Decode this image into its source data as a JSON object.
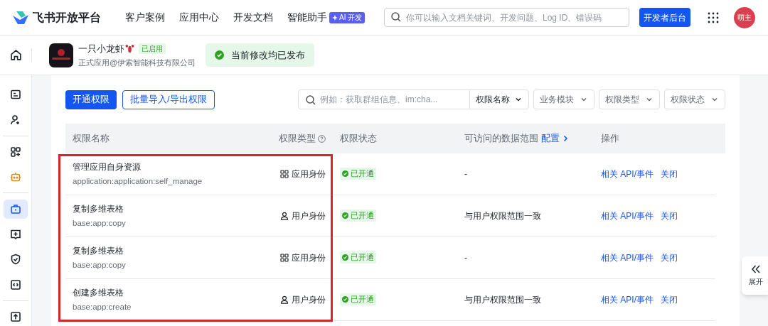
{
  "header": {
    "logo_text": "飞书开放平台",
    "nav": [
      {
        "label": "客户案例"
      },
      {
        "label": "应用中心"
      },
      {
        "label": "开发文档"
      },
      {
        "label": "智能助手",
        "badge": "AI 开发"
      }
    ],
    "search": {
      "placeholder": "你可以输入文档关键词、开发问题、Log ID、错误码"
    },
    "console_button": "开发者后台",
    "avatar": "萌主"
  },
  "app_bar": {
    "name": "一只小龙虾",
    "status": "已启用",
    "subtitle": "正式应用@伊索智能科技有限公司",
    "notice": "当前修改均已发布"
  },
  "sidebar": [
    {
      "kind": "console",
      "selected": false
    },
    {
      "kind": "user-add",
      "selected": false
    },
    {
      "kind": "divider"
    },
    {
      "kind": "apps",
      "selected": false
    },
    {
      "kind": "bot",
      "selected": false
    },
    {
      "kind": "divider"
    },
    {
      "kind": "briefcase",
      "selected": true
    },
    {
      "kind": "add-card",
      "selected": false
    },
    {
      "kind": "shield",
      "selected": false
    },
    {
      "kind": "code",
      "selected": false
    },
    {
      "kind": "divider"
    },
    {
      "kind": "upload",
      "selected": false
    }
  ],
  "toolbar": {
    "primary_button": "开通权限",
    "secondary_button": "批量导入/导出权限",
    "search": {
      "placeholder": "例如：获取群组信息、im:cha...",
      "scope": "权限名称"
    },
    "filters": [
      "业务模块",
      "权限类型",
      "权限状态"
    ]
  },
  "table": {
    "columns": [
      "权限名称",
      "权限类型",
      "权限状态",
      "可访问的数据范围",
      "操作"
    ],
    "configure_link": "配置",
    "rows": [
      {
        "name": "管理应用自身资源",
        "scope": "application:application:self_manage",
        "type": {
          "kind": "app",
          "label": "应用身份"
        },
        "status": "已开通",
        "data_range": "-",
        "actions": [
          "相关 API/事件",
          "关闭"
        ]
      },
      {
        "name": "复制多维表格",
        "scope": "base:app:copy",
        "type": {
          "kind": "user",
          "label": "用户身份"
        },
        "status": "已开通",
        "data_range": "与用户权限范围一致",
        "actions": [
          "相关 API/事件",
          "关闭"
        ]
      },
      {
        "name": "复制多维表格",
        "scope": "base:app:copy",
        "type": {
          "kind": "app",
          "label": "应用身份"
        },
        "status": "已开通",
        "data_range": "-",
        "actions": [
          "相关 API/事件",
          "关闭"
        ]
      },
      {
        "name": "创建多维表格",
        "scope": "base:app:create",
        "type": {
          "kind": "user",
          "label": "用户身份"
        },
        "status": "已开通",
        "data_range": "与用户权限范围一致",
        "actions": [
          "相关 API/事件",
          "关闭"
        ]
      }
    ]
  },
  "expand_button": "展开"
}
